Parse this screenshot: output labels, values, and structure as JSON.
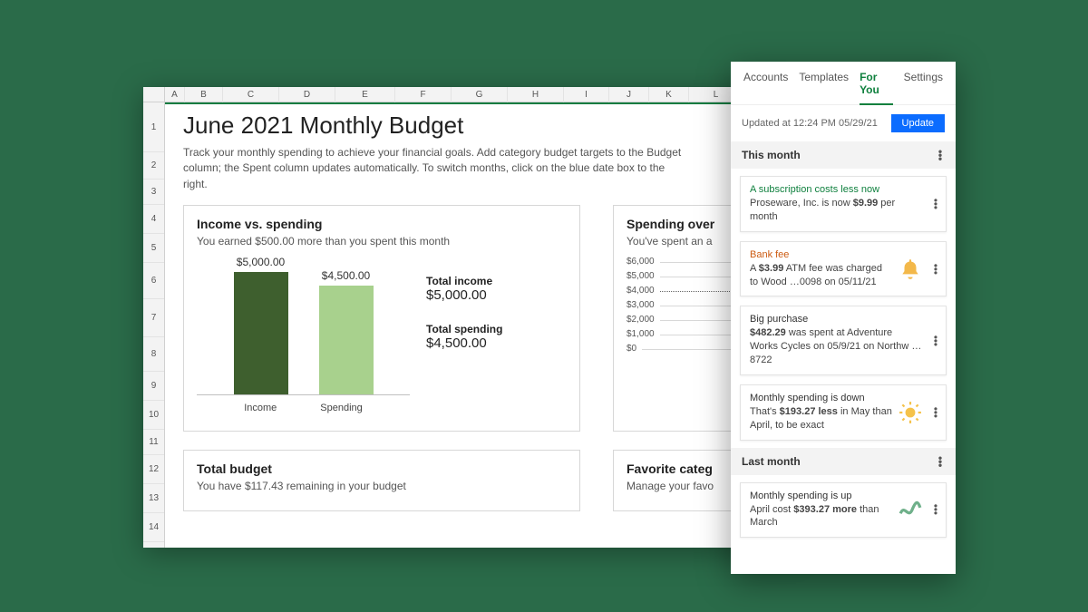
{
  "spreadsheet": {
    "columns": [
      "A",
      "B",
      "C",
      "D",
      "E",
      "F",
      "G",
      "H",
      "I",
      "J",
      "K",
      "L"
    ],
    "rows": [
      1,
      2,
      3,
      4,
      5,
      6,
      7,
      8,
      9,
      10,
      11,
      12,
      13,
      14
    ],
    "title": "June 2021 Monthly Budget",
    "subtitle": "Track your monthly spending to achieve your financial goals. Add category budget targets to the Budget column; the Spent column updates automatically. To switch months, click on the blue date box to the right."
  },
  "income_card": {
    "title": "Income vs. spending",
    "sub": "You earned $500.00 more than you spent this month",
    "income_label": "Income",
    "spending_label": "Spending",
    "income_value": "$5,000.00",
    "spending_value": "$4,500.00",
    "total_income_hdr": "Total income",
    "total_income_val": "$5,000.00",
    "total_spending_hdr": "Total spending",
    "total_spending_val": "$4,500.00"
  },
  "spendover_card": {
    "title": "Spending over",
    "sub": "You've spent an a",
    "axis": [
      "$6,000",
      "$5,000",
      "$4,000",
      "$3,000",
      "$2,000",
      "$1,000",
      "$0"
    ]
  },
  "totalbudget_card": {
    "title": "Total budget",
    "sub": "You have $117.43 remaining in your budget"
  },
  "fav_card": {
    "title": "Favorite categ",
    "sub": "Manage your favo"
  },
  "pane": {
    "tabs": [
      "Accounts",
      "Templates",
      "For You",
      "Settings"
    ],
    "active_tab": "For You",
    "updated": "Updated at 12:24 PM 05/29/21",
    "update_btn": "Update",
    "sections": {
      "this_month": "This month",
      "last_month": "Last month"
    },
    "insights_this": [
      {
        "headline": "A subscription costs less now",
        "hclass": "green",
        "body_pre": "Proseware, Inc. is now ",
        "bold": "$9.99",
        "body_post": " per month",
        "icon": ""
      },
      {
        "headline": "Bank fee",
        "hclass": "orange",
        "body_pre": "A ",
        "bold": "$3.99",
        "body_post": " ATM fee was charged to Wood …0098 on 05/11/21",
        "icon": "bell"
      },
      {
        "headline": "Big purchase",
        "hclass": "",
        "body_pre": "",
        "bold": "$482.29",
        "body_post": " was spent at Adventure Works Cycles on 05/9/21 on Northw …8722",
        "icon": ""
      },
      {
        "headline": "Monthly spending is down",
        "hclass": "",
        "body_pre": "That's ",
        "bold": "$193.27 less",
        "body_post": " in May than April, to be exact",
        "icon": "sun"
      }
    ],
    "insights_last": [
      {
        "headline": "Monthly spending is up",
        "hclass": "",
        "body_pre": "April cost ",
        "bold": "$393.27 more",
        "body_post": " than March",
        "icon": "wave"
      }
    ]
  },
  "chart_data": [
    {
      "type": "bar",
      "title": "Income vs. spending",
      "categories": [
        "Income",
        "Spending"
      ],
      "values": [
        5000,
        4500
      ],
      "ylabel": "USD",
      "ylim": [
        0,
        6000
      ]
    },
    {
      "type": "line",
      "title": "Spending over time",
      "ylabel": "USD",
      "ylim": [
        0,
        6000
      ],
      "y_ticks": [
        0,
        1000,
        2000,
        3000,
        4000,
        5000,
        6000
      ],
      "x": [],
      "series": []
    }
  ]
}
